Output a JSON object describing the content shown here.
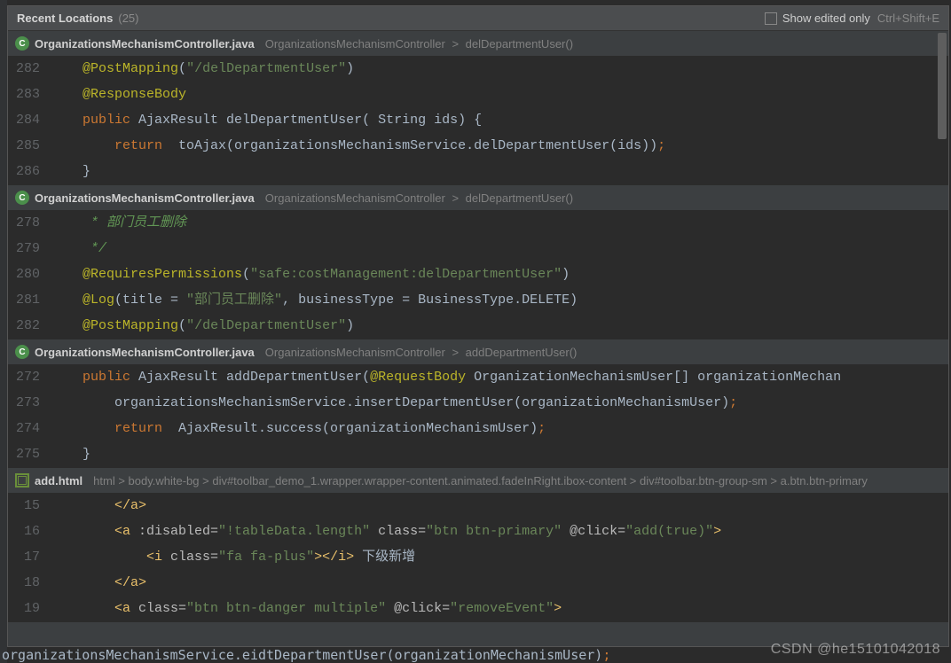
{
  "header": {
    "title": "Recent Locations",
    "count_label": "(25)",
    "show_edited_label": "Show edited only",
    "shortcut": "Ctrl+Shift+E"
  },
  "entries": [
    {
      "icon_letter": "C",
      "icon_class": "java",
      "file": "OrganizationsMechanismController.java",
      "path_prefix": "OrganizationsMechanismController",
      "path_method": "delDepartmentUser()",
      "lines": [
        {
          "n": "282",
          "segs": [
            {
              "t": "    ",
              "c": "plain"
            },
            {
              "t": "@PostMapping",
              "c": "ann"
            },
            {
              "t": "(",
              "c": "punc"
            },
            {
              "t": "\"/delDepartmentUser\"",
              "c": "str"
            },
            {
              "t": ")",
              "c": "punc"
            }
          ]
        },
        {
          "n": "283",
          "segs": [
            {
              "t": "    ",
              "c": "plain"
            },
            {
              "t": "@ResponseBody",
              "c": "ann"
            }
          ]
        },
        {
          "n": "284",
          "segs": [
            {
              "t": "    ",
              "c": "plain"
            },
            {
              "t": "public ",
              "c": "kw"
            },
            {
              "t": "AjaxResult delDepartmentUser( String ids) {",
              "c": "plain"
            }
          ]
        },
        {
          "n": "285",
          "segs": [
            {
              "t": "        ",
              "c": "plain"
            },
            {
              "t": "return  ",
              "c": "kw"
            },
            {
              "t": "toAjax(organizationsMechanismService.delDepartmentUser(ids))",
              "c": "plain"
            },
            {
              "t": ";",
              "c": "kw"
            }
          ]
        },
        {
          "n": "286",
          "segs": [
            {
              "t": "    }",
              "c": "plain"
            }
          ]
        }
      ]
    },
    {
      "icon_letter": "C",
      "icon_class": "java",
      "file": "OrganizationsMechanismController.java",
      "path_prefix": "OrganizationsMechanismController",
      "path_method": "delDepartmentUser()",
      "lines": [
        {
          "n": "278",
          "segs": [
            {
              "t": "     * 部门员工删除",
              "c": "comment"
            }
          ]
        },
        {
          "n": "279",
          "segs": [
            {
              "t": "     */",
              "c": "comment"
            }
          ]
        },
        {
          "n": "280",
          "segs": [
            {
              "t": "    ",
              "c": "plain"
            },
            {
              "t": "@RequiresPermissions",
              "c": "ann"
            },
            {
              "t": "(",
              "c": "punc"
            },
            {
              "t": "\"safe:costManagement:delDepartmentUser\"",
              "c": "str"
            },
            {
              "t": ")",
              "c": "punc"
            }
          ]
        },
        {
          "n": "281",
          "segs": [
            {
              "t": "    ",
              "c": "plain"
            },
            {
              "t": "@Log",
              "c": "ann"
            },
            {
              "t": "(title = ",
              "c": "plain"
            },
            {
              "t": "\"部门员工删除\"",
              "c": "str"
            },
            {
              "t": ", businessType = BusinessType.DELETE)",
              "c": "plain"
            }
          ]
        },
        {
          "n": "282",
          "segs": [
            {
              "t": "    ",
              "c": "plain"
            },
            {
              "t": "@PostMapping",
              "c": "ann"
            },
            {
              "t": "(",
              "c": "punc"
            },
            {
              "t": "\"/delDepartmentUser\"",
              "c": "str"
            },
            {
              "t": ")",
              "c": "punc"
            }
          ]
        }
      ]
    },
    {
      "icon_letter": "C",
      "icon_class": "java",
      "file": "OrganizationsMechanismController.java",
      "path_prefix": "OrganizationsMechanismController",
      "path_method": "addDepartmentUser()",
      "lines": [
        {
          "n": "272",
          "segs": [
            {
              "t": "    ",
              "c": "plain"
            },
            {
              "t": "public ",
              "c": "kw"
            },
            {
              "t": "AjaxResult addDepartmentUser(",
              "c": "plain"
            },
            {
              "t": "@RequestBody ",
              "c": "ann"
            },
            {
              "t": "OrganizationMechanismUser[] organizationMechan",
              "c": "plain"
            }
          ]
        },
        {
          "n": "273",
          "segs": [
            {
              "t": "        organizationsMechanismService.insertDepartmentUser(organizationMechanismUser)",
              "c": "plain"
            },
            {
              "t": ";",
              "c": "kw"
            }
          ]
        },
        {
          "n": "274",
          "segs": [
            {
              "t": "        ",
              "c": "plain"
            },
            {
              "t": "return  ",
              "c": "kw"
            },
            {
              "t": "AjaxResult.success(organizationMechanismUser)",
              "c": "plain"
            },
            {
              "t": ";",
              "c": "kw"
            }
          ]
        },
        {
          "n": "275",
          "segs": [
            {
              "t": "    }",
              "c": "plain"
            }
          ]
        }
      ]
    },
    {
      "icon_letter": "",
      "icon_class": "html",
      "file": "add.html",
      "breadcrumb": "html  >  body.white-bg  >  div#toolbar_demo_1.wrapper.wrapper-content.animated.fadeInRight.ibox-content  >  div#toolbar.btn-group-sm  >  a.btn.btn-primary",
      "lines": [
        {
          "n": "15",
          "segs": [
            {
              "t": "        ",
              "c": "plain"
            },
            {
              "t": "</a>",
              "c": "tag"
            }
          ]
        },
        {
          "n": "16",
          "segs": [
            {
              "t": "        ",
              "c": "plain"
            },
            {
              "t": "<a ",
              "c": "tag"
            },
            {
              "t": ":disabled=",
              "c": "attrn"
            },
            {
              "t": "\"!tableData.length\" ",
              "c": "str"
            },
            {
              "t": "class=",
              "c": "attrn"
            },
            {
              "t": "\"btn btn-primary\" ",
              "c": "str"
            },
            {
              "t": "@click=",
              "c": "attrn"
            },
            {
              "t": "\"add(true)\"",
              "c": "str"
            },
            {
              "t": ">",
              "c": "tag"
            }
          ]
        },
        {
          "n": "17",
          "segs": [
            {
              "t": "            ",
              "c": "plain"
            },
            {
              "t": "<i ",
              "c": "tag"
            },
            {
              "t": "class=",
              "c": "attrn"
            },
            {
              "t": "\"fa fa-plus\"",
              "c": "str"
            },
            {
              "t": "></i> ",
              "c": "tag"
            },
            {
              "t": "下级新增",
              "c": "text-cn"
            }
          ]
        },
        {
          "n": "18",
          "segs": [
            {
              "t": "        ",
              "c": "plain"
            },
            {
              "t": "</a>",
              "c": "tag"
            }
          ]
        },
        {
          "n": "19",
          "segs": [
            {
              "t": "        ",
              "c": "plain"
            },
            {
              "t": "<a ",
              "c": "tag"
            },
            {
              "t": "class=",
              "c": "attrn"
            },
            {
              "t": "\"btn btn-danger multiple\" ",
              "c": "str"
            },
            {
              "t": "@click=",
              "c": "attrn"
            },
            {
              "t": "\"removeEvent\"",
              "c": "str"
            },
            {
              "t": ">",
              "c": "tag"
            }
          ]
        }
      ]
    }
  ],
  "bottom_line_segs": [
    {
      "t": "organizationsMechanismService",
      "c": "plain"
    },
    {
      "t": ".eidtDepartmentUser(organizationMechanismUser)",
      "c": "plain"
    },
    {
      "t": ";",
      "c": "kw"
    }
  ],
  "watermark": "CSDN @he15101042018",
  "left_chars": [
    "o",
    "r",
    "",
    "",
    "",
    "",
    "",
    "",
    "",
    "",
    "",
    "",
    "",
    "",
    "",
    "",
    "",
    "",
    "",
    "",
    "",
    "",
    "",
    "",
    ""
  ]
}
